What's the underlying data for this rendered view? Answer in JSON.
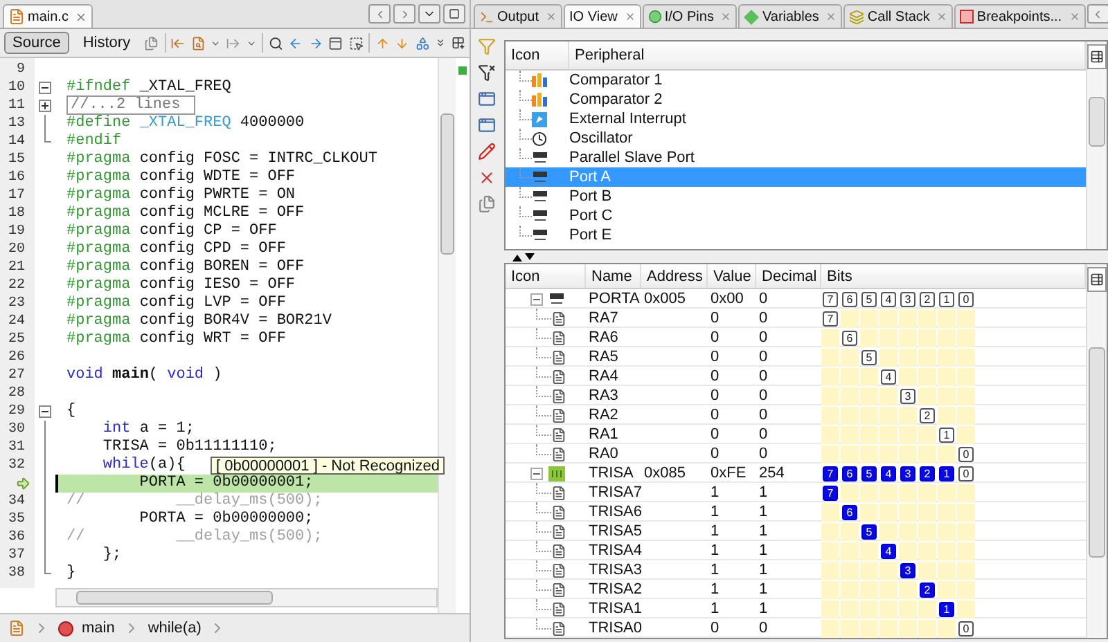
{
  "editor": {
    "tab": {
      "label": "main.c",
      "selected": true
    },
    "view_buttons": [
      {
        "label": "Source",
        "selected": true
      },
      {
        "label": "History",
        "selected": false
      }
    ],
    "lines": [
      {
        "number": "9",
        "kind": "plain",
        "current": false
      },
      {
        "number": "10",
        "kind": "fold_open",
        "current": false,
        "tokens": [
          {
            "kind": "directive",
            "text": "#ifndef"
          },
          {
            "kind": "plain",
            "text": " _XTAL_FREQ"
          }
        ]
      },
      {
        "number": "11",
        "kind": "fold_closed",
        "current": false,
        "tokens": [
          {
            "kind": "folded",
            "text": "//...2 lines"
          }
        ]
      },
      {
        "number": "13",
        "kind": "fold_inside",
        "current": false,
        "tokens": [
          {
            "kind": "directive",
            "text": "#define "
          },
          {
            "kind": "macro",
            "text": "_XTAL_FREQ"
          },
          {
            "kind": "plain",
            "text": " 4000000"
          }
        ]
      },
      {
        "number": "14",
        "kind": "fold_end",
        "current": false,
        "tokens": [
          {
            "kind": "directive",
            "text": "#endif"
          }
        ]
      },
      {
        "number": "15",
        "kind": "plain",
        "current": false,
        "tokens": [
          {
            "kind": "directive",
            "text": "#pragma "
          },
          {
            "kind": "plain",
            "text": "config FOSC = INTRC_CLKOUT"
          }
        ]
      },
      {
        "number": "16",
        "kind": "plain",
        "current": false,
        "tokens": [
          {
            "kind": "directive",
            "text": "#pragma "
          },
          {
            "kind": "plain",
            "text": "config WDTE = OFF"
          }
        ]
      },
      {
        "number": "17",
        "kind": "plain",
        "current": false,
        "tokens": [
          {
            "kind": "directive",
            "text": "#pragma "
          },
          {
            "kind": "plain",
            "text": "config PWRTE = ON"
          }
        ]
      },
      {
        "number": "18",
        "kind": "plain",
        "current": false,
        "tokens": [
          {
            "kind": "directive",
            "text": "#pragma "
          },
          {
            "kind": "plain",
            "text": "config MCLRE = OFF"
          }
        ]
      },
      {
        "number": "19",
        "kind": "plain",
        "current": false,
        "tokens": [
          {
            "kind": "directive",
            "text": "#pragma "
          },
          {
            "kind": "plain",
            "text": "config CP = OFF"
          }
        ]
      },
      {
        "number": "20",
        "kind": "plain",
        "current": false,
        "tokens": [
          {
            "kind": "directive",
            "text": "#pragma "
          },
          {
            "kind": "plain",
            "text": "config CPD = OFF"
          }
        ]
      },
      {
        "number": "21",
        "kind": "plain",
        "current": false,
        "tokens": [
          {
            "kind": "directive",
            "text": "#pragma "
          },
          {
            "kind": "plain",
            "text": "config BOREN = OFF"
          }
        ]
      },
      {
        "number": "22",
        "kind": "plain",
        "current": false,
        "tokens": [
          {
            "kind": "directive",
            "text": "#pragma "
          },
          {
            "kind": "plain",
            "text": "config IESO = OFF"
          }
        ]
      },
      {
        "number": "23",
        "kind": "plain",
        "current": false,
        "tokens": [
          {
            "kind": "directive",
            "text": "#pragma "
          },
          {
            "kind": "plain",
            "text": "config LVP = OFF"
          }
        ]
      },
      {
        "number": "24",
        "kind": "plain",
        "current": false,
        "tokens": [
          {
            "kind": "directive",
            "text": "#pragma "
          },
          {
            "kind": "plain",
            "text": "config BOR4V = BOR21V"
          }
        ]
      },
      {
        "number": "25",
        "kind": "plain",
        "current": false,
        "tokens": [
          {
            "kind": "directive",
            "text": "#pragma "
          },
          {
            "kind": "plain",
            "text": "config WRT = OFF"
          }
        ]
      },
      {
        "number": "26",
        "kind": "plain",
        "current": false
      },
      {
        "number": "27",
        "kind": "plain",
        "current": false,
        "tokens": [
          {
            "kind": "keyword",
            "text": "void "
          },
          {
            "kind": "function",
            "text": "main"
          },
          {
            "kind": "plain",
            "text": "( "
          },
          {
            "kind": "keyword",
            "text": "void"
          },
          {
            "kind": "plain",
            "text": " )"
          }
        ]
      },
      {
        "number": "28",
        "kind": "plain",
        "current": false
      },
      {
        "number": "29",
        "kind": "fold_open",
        "current": false,
        "tokens": [
          {
            "kind": "plain",
            "text": "{"
          }
        ]
      },
      {
        "number": "30",
        "kind": "fold_inside",
        "current": false,
        "tokens": [
          {
            "kind": "keyword",
            "text": "    int"
          },
          {
            "kind": "plain",
            "text": " a = 1;"
          }
        ]
      },
      {
        "number": "31",
        "kind": "fold_inside",
        "current": false,
        "tokens": [
          {
            "kind": "plain",
            "text": "    TRISA = 0b11111110;"
          }
        ]
      },
      {
        "number": "32",
        "kind": "fold_inside",
        "current": false,
        "tokens": [
          {
            "kind": "keyword",
            "text": "    while"
          },
          {
            "kind": "plain",
            "text": "(a){"
          }
        ]
      },
      {
        "kind": "fold_inside",
        "current": true,
        "tokens": [
          {
            "kind": "plain",
            "text": "        PORTA = 0b00000001;"
          }
        ]
      },
      {
        "number": "34",
        "kind": "fold_inside",
        "current": false,
        "tokens": [
          {
            "kind": "comment",
            "text": "//          __delay_ms(500);"
          }
        ]
      },
      {
        "number": "35",
        "kind": "fold_inside",
        "current": false,
        "tokens": [
          {
            "kind": "plain",
            "text": "        PORTA = 0b00000000;"
          }
        ]
      },
      {
        "number": "36",
        "kind": "fold_inside",
        "current": false,
        "tokens": [
          {
            "kind": "comment",
            "text": "//          __delay_ms(500);"
          }
        ]
      },
      {
        "number": "37",
        "kind": "fold_inside",
        "current": false,
        "tokens": [
          {
            "kind": "plain",
            "text": "    };"
          }
        ]
      },
      {
        "number": "38",
        "kind": "fold_end",
        "current": false,
        "tokens": [
          {
            "kind": "plain",
            "text": "}"
          }
        ]
      }
    ],
    "tooltip": "[ 0b00000001 ] - Not Recognized",
    "breadcrumbs": [
      {
        "kind": "function",
        "label": "main"
      },
      {
        "kind": "block",
        "label": "while(a)"
      }
    ]
  },
  "io": {
    "tabs": [
      {
        "kind": "output",
        "label": "Output",
        "selected": false
      },
      {
        "kind": "view",
        "label": "IO View",
        "selected": true
      },
      {
        "kind": "pins",
        "label": "I/O Pins",
        "selected": false
      },
      {
        "kind": "variables",
        "label": "Variables",
        "selected": false
      },
      {
        "kind": "callstack",
        "label": "Call Stack",
        "selected": false
      },
      {
        "kind": "breakpoints",
        "label": "Breakpoints...",
        "selected": false
      }
    ],
    "peripheral_table": {
      "columns": [
        "Icon",
        "Peripheral"
      ],
      "rows": [
        {
          "kind": "comparator",
          "label": "Comparator 1",
          "selected": false
        },
        {
          "kind": "comparator",
          "label": "Comparator 2",
          "selected": false
        },
        {
          "kind": "interrupt",
          "label": "External Interrupt",
          "selected": false
        },
        {
          "kind": "oscillator",
          "label": "Oscillator",
          "selected": false
        },
        {
          "kind": "port",
          "label": "Parallel Slave Port",
          "selected": false
        },
        {
          "kind": "port",
          "label": "Port A",
          "selected": true
        },
        {
          "kind": "port",
          "label": "Port B",
          "selected": false
        },
        {
          "kind": "port",
          "label": "Port C",
          "selected": false
        },
        {
          "kind": "port",
          "label": "Port E",
          "selected": false
        }
      ]
    },
    "register_table": {
      "columns": [
        "Icon",
        "Name",
        "Address",
        "Value",
        "Decimal",
        "Bits"
      ],
      "registers": [
        {
          "kind": "port",
          "name": "PORTA",
          "address": "0x005",
          "value": "0x00",
          "decimal": "0",
          "expanded": true,
          "bits": [
            {
              "label": "7",
              "on": false
            },
            {
              "label": "6",
              "on": false
            },
            {
              "label": "5",
              "on": false
            },
            {
              "label": "4",
              "on": false
            },
            {
              "label": "3",
              "on": false
            },
            {
              "label": "2",
              "on": false
            },
            {
              "label": "1",
              "on": false
            },
            {
              "label": "0",
              "on": false
            }
          ],
          "children": [
            {
              "name": "RA7",
              "value": "0",
              "decimal": "0",
              "bit": {
                "label": "7",
                "on": false
              }
            },
            {
              "name": "RA6",
              "value": "0",
              "decimal": "0",
              "bit": {
                "label": "6",
                "on": false
              }
            },
            {
              "name": "RA5",
              "value": "0",
              "decimal": "0",
              "bit": {
                "label": "5",
                "on": false
              }
            },
            {
              "name": "RA4",
              "value": "0",
              "decimal": "0",
              "bit": {
                "label": "4",
                "on": false
              }
            },
            {
              "name": "RA3",
              "value": "0",
              "decimal": "0",
              "bit": {
                "label": "3",
                "on": false
              }
            },
            {
              "name": "RA2",
              "value": "0",
              "decimal": "0",
              "bit": {
                "label": "2",
                "on": false
              }
            },
            {
              "name": "RA1",
              "value": "0",
              "decimal": "0",
              "bit": {
                "label": "1",
                "on": false
              }
            },
            {
              "name": "RA0",
              "value": "0",
              "decimal": "0",
              "bit": {
                "label": "0",
                "on": false
              }
            }
          ]
        },
        {
          "kind": "tris",
          "name": "TRISA",
          "address": "0x085",
          "value": "0xFE",
          "decimal": "254",
          "expanded": true,
          "bits": [
            {
              "label": "7",
              "on": true
            },
            {
              "label": "6",
              "on": true
            },
            {
              "label": "5",
              "on": true
            },
            {
              "label": "4",
              "on": true
            },
            {
              "label": "3",
              "on": true
            },
            {
              "label": "2",
              "on": true
            },
            {
              "label": "1",
              "on": true
            },
            {
              "label": "0",
              "on": false
            }
          ],
          "children": [
            {
              "name": "TRISA7",
              "value": "1",
              "decimal": "1",
              "bit": {
                "label": "7",
                "on": true
              }
            },
            {
              "name": "TRISA6",
              "value": "1",
              "decimal": "1",
              "bit": {
                "label": "6",
                "on": true
              }
            },
            {
              "name": "TRISA5",
              "value": "1",
              "decimal": "1",
              "bit": {
                "label": "5",
                "on": true
              }
            },
            {
              "name": "TRISA4",
              "value": "1",
              "decimal": "1",
              "bit": {
                "label": "4",
                "on": true
              }
            },
            {
              "name": "TRISA3",
              "value": "1",
              "decimal": "1",
              "bit": {
                "label": "3",
                "on": true
              }
            },
            {
              "name": "TRISA2",
              "value": "1",
              "decimal": "1",
              "bit": {
                "label": "2",
                "on": true
              }
            },
            {
              "name": "TRISA1",
              "value": "1",
              "decimal": "1",
              "bit": {
                "label": "1",
                "on": true
              }
            },
            {
              "name": "TRISA0",
              "value": "0",
              "decimal": "0",
              "bit": {
                "label": "0",
                "on": false
              }
            }
          ]
        }
      ]
    }
  }
}
